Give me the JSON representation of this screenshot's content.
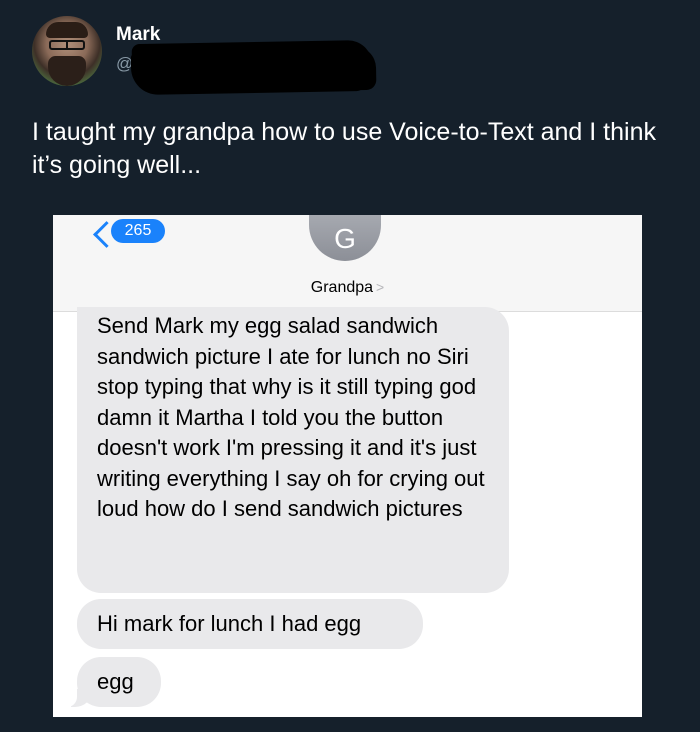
{
  "tweet": {
    "display_name": "Mark",
    "handle": "@",
    "text": "I taught my grandpa how to use Voice-to-Text and I think it’s going well..."
  },
  "messages_screenshot": {
    "back_badge_count": "265",
    "contact_initial": "G",
    "contact_name": "Grandpa",
    "contact_chevron": ">",
    "bubbles": [
      {
        "text": "Send Mark my egg salad sandwich sandwich picture I ate for lunch no Siri stop typing that why is it still typing god damn it Martha I told you the button doesn't work I'm pressing it and it's just writing everything I say oh for crying out loud how do I send sandwich pictures"
      },
      {
        "text": "Hi mark for lunch I had egg"
      },
      {
        "text": "egg"
      }
    ]
  },
  "colors": {
    "background": "#15202b",
    "ios_blue": "#1a82fb",
    "bubble_gray": "#e9e9eb"
  }
}
